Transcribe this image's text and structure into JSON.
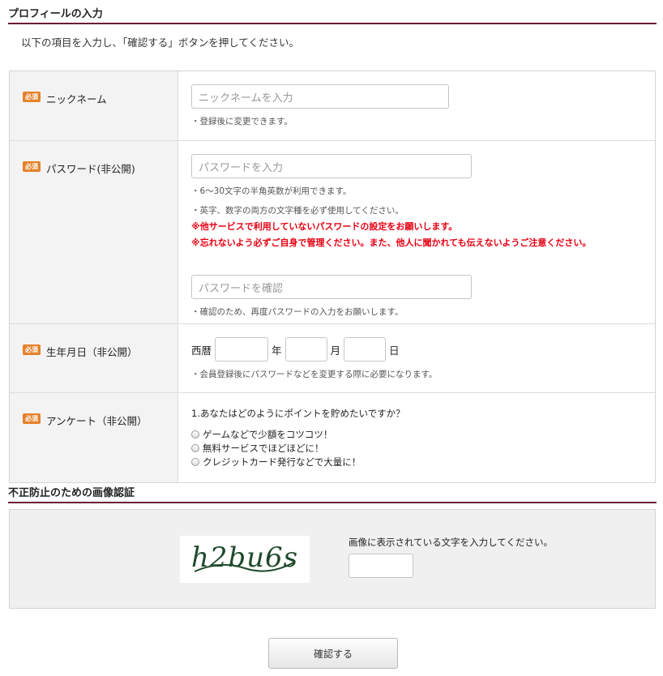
{
  "profile_section": {
    "title": "プロフィールの入力",
    "intro": "以下の項目を入力し、「確認する」ボタンを押してください。"
  },
  "required_badge": "必須",
  "nickname": {
    "label": "ニックネーム",
    "placeholder": "ニックネームを入力",
    "note": "・登録後に変更できます。"
  },
  "password": {
    "label": "パスワード(非公開)",
    "placeholder": "パスワードを入力",
    "note1": "・6～30文字の半角英数が利用できます。",
    "note2": "・英字、数字の両方の文字種を必ず使用してください。",
    "warning1": "※他サービスで利用していないパスワードの設定をお願いします。",
    "warning2": "※忘れないよう必ずご自身で管理ください。また、他人に聞かれても伝えないようご注意ください。",
    "confirm_placeholder": "パスワードを確認",
    "confirm_note": "・確認のため、再度パスワードの入力をお願いします。"
  },
  "birthday": {
    "label": "生年月日（非公開）",
    "era": "西暦",
    "year": "年",
    "month": "月",
    "day": "日",
    "note": "・会員登録後にパスワードなどを変更する際に必要になります。"
  },
  "survey": {
    "label": "アンケート（非公開）",
    "question": "1.あなたはどのようにポイントを貯めたいですか？",
    "options": [
      "ゲームなどで少額をコツコツ！",
      "無料サービスでほどほどに！",
      "クレジットカード発行などで大量に！"
    ]
  },
  "captcha_section": {
    "title": "不正防止のための画像認証",
    "image_text": "h2bu6s",
    "instruction": "画像に表示されている文字を入力してください。"
  },
  "submit_label": "確認する"
}
